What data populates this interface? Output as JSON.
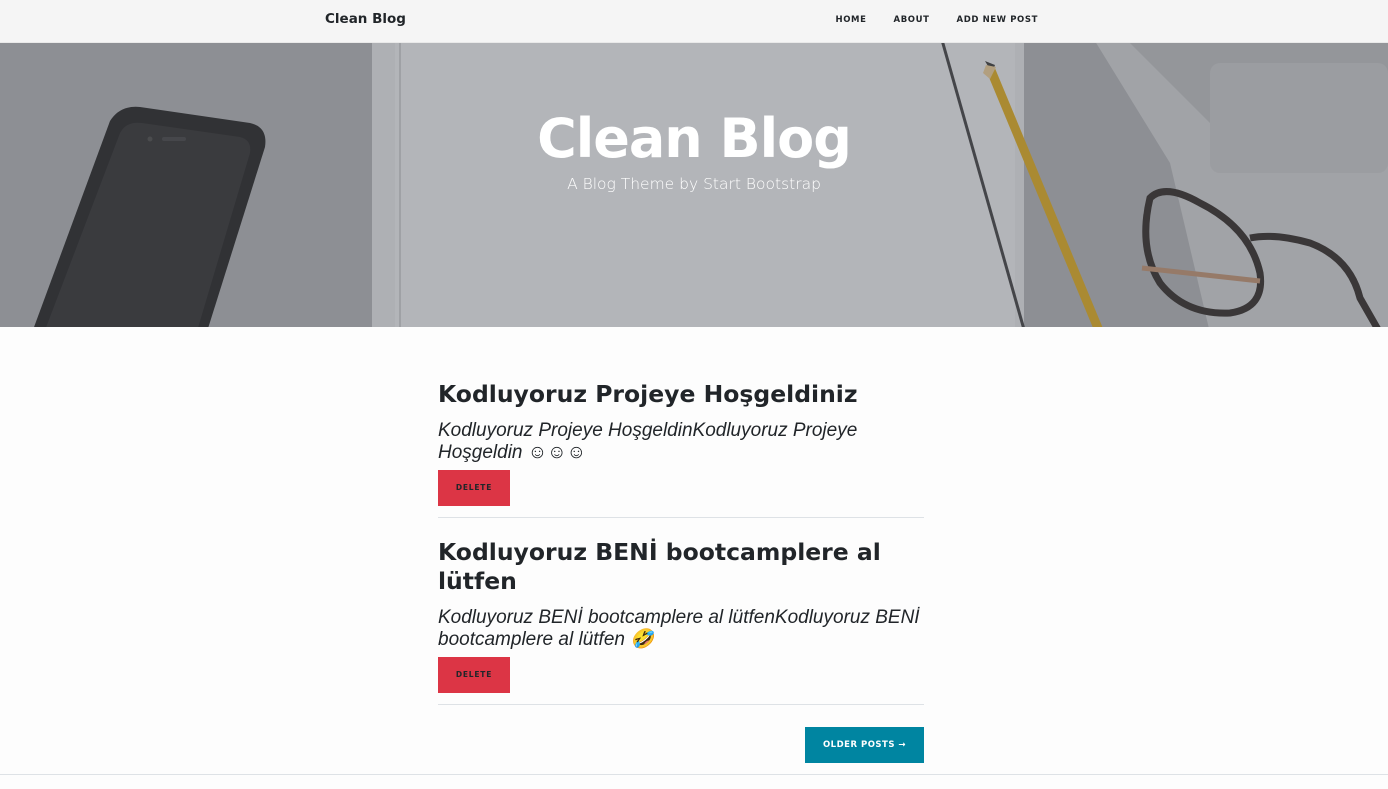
{
  "nav": {
    "brand": "Clean Blog",
    "links": [
      "HOME",
      "ABOUT",
      "ADD NEW POST"
    ]
  },
  "hero": {
    "title": "Clean Blog",
    "subtitle": "A Blog Theme by Start Bootstrap"
  },
  "posts": [
    {
      "title": "Kodluyoruz Projeye Hoşgeldiniz",
      "text": "Kodluyoruz Projeye HoşgeldinKodluyoruz Projeye Hoşgeldin ☺☺☺",
      "delete_label": "DELETE"
    },
    {
      "title": "Kodluyoruz BENİ bootcamplere al lütfen",
      "text": "Kodluyoruz BENİ bootcamplere al lütfenKodluyoruz BENİ bootcamplere al lütfen 🤣",
      "delete_label": "DELETE"
    }
  ],
  "pager": {
    "older_label": "OLDER POSTS →"
  },
  "colors": {
    "delete": "#dc3545",
    "primary": "#0085a1",
    "navbar": "#f5f5f5"
  }
}
